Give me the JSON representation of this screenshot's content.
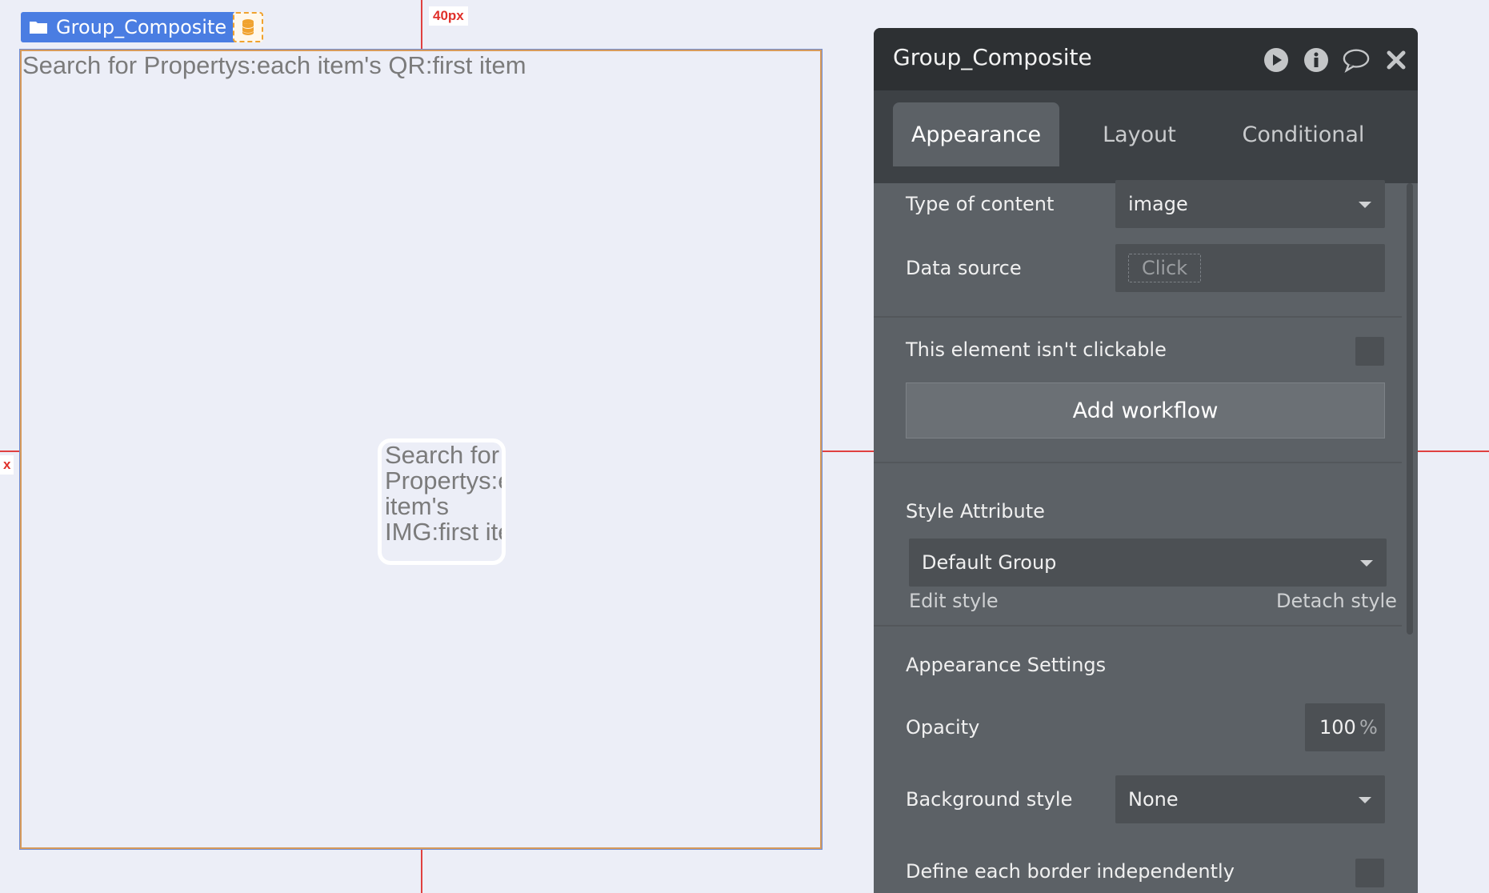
{
  "canvas": {
    "tag_label": "Group_Composite",
    "distance_label": "40px",
    "side_label": "x",
    "group_text": "Search for Propertys:each item's QR:first item",
    "inner_text": "Search for Propertys:each item's IMG:first item"
  },
  "panel": {
    "title": "Group_Composite",
    "header_icons": [
      "play-icon",
      "info-icon",
      "comment-icon",
      "close-icon"
    ],
    "tabs": [
      {
        "label": "Appearance",
        "active": true
      },
      {
        "label": "Layout",
        "active": false
      },
      {
        "label": "Conditional",
        "active": false
      }
    ],
    "type_of_content": {
      "label": "Type of content",
      "value": "image"
    },
    "data_source": {
      "label": "Data source",
      "placeholder": "Click"
    },
    "not_clickable": {
      "label": "This element isn't clickable",
      "checked": false
    },
    "add_workflow": "Add workflow",
    "style_attribute": {
      "label": "Style Attribute",
      "value": "Default Group",
      "edit_style": "Edit style",
      "detach_style": "Detach style"
    },
    "appearance_settings": "Appearance Settings",
    "opacity": {
      "label": "Opacity",
      "value": "100",
      "unit": "%"
    },
    "background_style": {
      "label": "Background style",
      "value": "None"
    },
    "define_border": {
      "label": "Define each border independently",
      "checked": false
    }
  },
  "colors": {
    "canvas_bg": "#eceef7",
    "guide_red": "#e04040",
    "tag_blue": "#4a7de2",
    "panel_bg": "#5c6166",
    "panel_header": "#2d3033"
  }
}
